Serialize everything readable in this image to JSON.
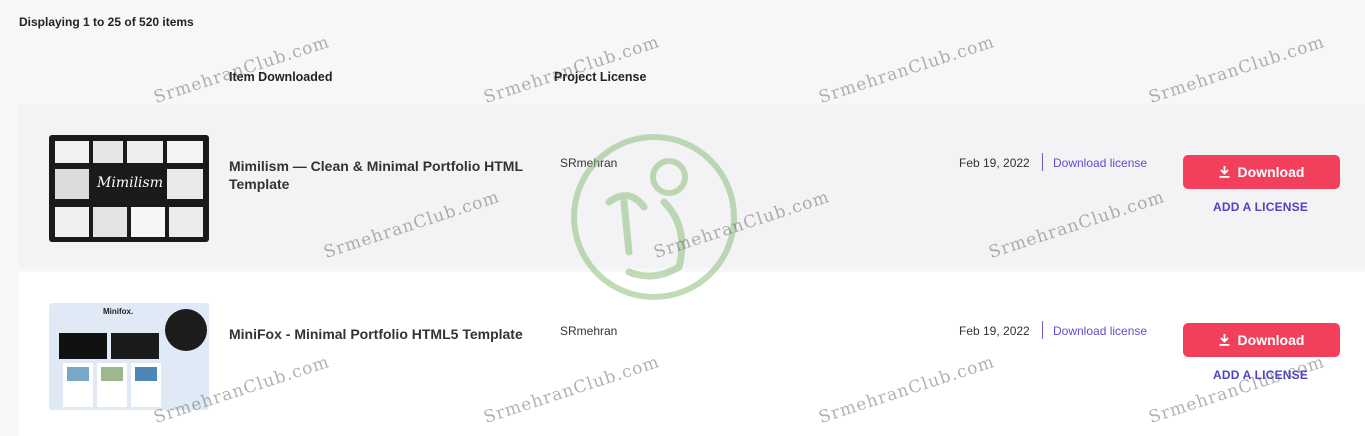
{
  "list": {
    "count_text": "Displaying 1 to 25 of 520 items",
    "columns": {
      "item": "Item Downloaded",
      "license": "Project License"
    },
    "rows": [
      {
        "title": "Mimilism — Clean & Minimal Portfolio HTML Template",
        "author": "SRmehran",
        "date": "Feb 19, 2022",
        "download_license": "Download license",
        "download_button": "Download",
        "add_license": "ADD A LICENSE",
        "thumbnail_caption": "Mimilism"
      },
      {
        "title": "MiniFox - Minimal Portfolio HTML5 Template",
        "author": "SRmehran",
        "date": "Feb 19, 2022",
        "download_license": "Download license",
        "download_button": "Download",
        "add_license": "ADD A LICENSE",
        "thumbnail_caption": "Minifox."
      }
    ]
  },
  "watermark": {
    "text": "SrmehranClub.com",
    "symbol": "©"
  },
  "colors": {
    "download_button": "#f2405c",
    "link": "#5a4fcf",
    "page_background": "#f7f7f9"
  }
}
